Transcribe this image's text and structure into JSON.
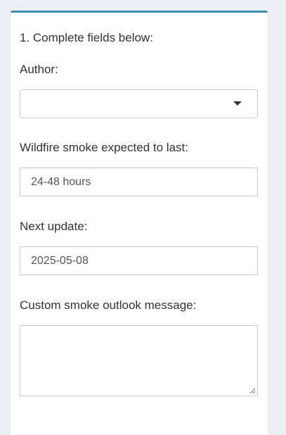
{
  "form": {
    "step_label": "1. Complete fields below:",
    "author": {
      "label": "Author:",
      "value": ""
    },
    "smoke_duration": {
      "label": "Wildfire smoke expected to last:",
      "value": "24-48 hours"
    },
    "next_update": {
      "label": "Next update:",
      "value": "2025-05-08"
    },
    "custom_message": {
      "label": "Custom smoke outlook message:",
      "value": ""
    }
  },
  "icons": {
    "select_caret": "caret-down-icon",
    "resize_grip": "resize-grip-icon"
  },
  "colors": {
    "page_background": "#ecf0f5",
    "panel_background": "#ffffff",
    "panel_top_border": "#3c8dbc",
    "field_border": "#cccccc",
    "text": "#333333"
  }
}
